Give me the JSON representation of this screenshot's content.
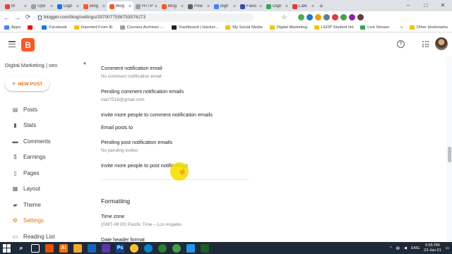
{
  "browser": {
    "tabs": [
      {
        "label": "M",
        "color": "#ea4335",
        "active": false
      },
      {
        "label": "Upd",
        "color": "#9e9e9e",
        "active": false
      },
      {
        "label": "Digit",
        "color": "#1a73e8",
        "active": false
      },
      {
        "label": "Blog",
        "color": "#ff5722",
        "active": false
      },
      {
        "label": "Blog",
        "color": "#ff5722",
        "active": true
      },
      {
        "label": "HTTP",
        "color": "#9e9e9e",
        "active": false
      },
      {
        "label": "Blog",
        "color": "#ff5722",
        "active": false
      },
      {
        "label": "Pow",
        "color": "#5f6368",
        "active": false
      },
      {
        "label": "digit",
        "color": "#4285f4",
        "active": false
      },
      {
        "label": "Favic",
        "color": "#3949ab",
        "active": false
      },
      {
        "label": "Digit",
        "color": "#34a853",
        "active": false
      },
      {
        "label": "Late",
        "color": "#e53935",
        "active": false
      }
    ],
    "tab_close": "×",
    "new_tab": "+",
    "window_controls": {
      "minimize": "–",
      "maximize": "□",
      "close": "✕"
    },
    "url": "blogger.com/blog/settings/2970077558753576273",
    "back": "←",
    "forward": "→",
    "reload": "⟳",
    "star": "☆"
  },
  "bookmarks": {
    "items": [
      {
        "label": "Apps",
        "color": "#4285f4"
      },
      {
        "label": "",
        "color": "#ff0000"
      },
      {
        "label": "Facebook",
        "color": "#1877f2"
      },
      {
        "label": "Imported From IE",
        "color": "#f4c20d"
      },
      {
        "label": "Courses Archives -...",
        "color": "#9e9e9e"
      },
      {
        "label": "Dashboard | Hacker...",
        "color": "#212121"
      },
      {
        "label": "My Social Media",
        "color": "#f4c20d"
      },
      {
        "label": "Digital Marketing",
        "color": "#f4c20d"
      },
      {
        "label": "LEDP Student list",
        "color": "#f4c20d"
      },
      {
        "label": "Live Stream",
        "color": "#34a853"
      }
    ],
    "more": "»",
    "other": "Other bookmarks"
  },
  "header": {
    "logo_letter": "B"
  },
  "sidebar": {
    "blog_name": "Digital Marketing | seo",
    "new_post": "NEW POST",
    "items": [
      {
        "label": "Posts",
        "icon": "▤"
      },
      {
        "label": "Stats",
        "icon": "▮"
      },
      {
        "label": "Comments",
        "icon": "▬"
      },
      {
        "label": "Earnings",
        "icon": "$"
      },
      {
        "label": "Pages",
        "icon": "▯"
      },
      {
        "label": "Layout",
        "icon": "▦"
      },
      {
        "label": "Theme",
        "icon": "▰"
      },
      {
        "label": "Settings",
        "icon": "⚙",
        "active": true
      },
      {
        "label": "Reading List",
        "icon": "▭"
      }
    ]
  },
  "settings": {
    "comment_notification_email": {
      "title": "Comment notification email",
      "value": "No comment notification email"
    },
    "pending_comment_notification_emails": {
      "title": "Pending comment notification emails",
      "value": "niaz7518@gmail.com"
    },
    "invite_comment": {
      "title": "Invite more people to comment notification emails"
    },
    "email_posts_to": {
      "title": "Email posts to"
    },
    "pending_post_notification_emails": {
      "title": "Pending post notification emails",
      "value": "No pending invites"
    },
    "invite_post": {
      "title": "Invite more people to post notifications"
    },
    "formatting_section": "Formatting",
    "time_zone": {
      "title": "Time zone",
      "value": "(GMT-08:00) Pacific Time – Los Angeles"
    },
    "date_header_format": {
      "title": "Date header format"
    }
  },
  "taskbar": {
    "lang": "ENG",
    "time": "9:55 PM",
    "date": "23-Jan-21"
  }
}
